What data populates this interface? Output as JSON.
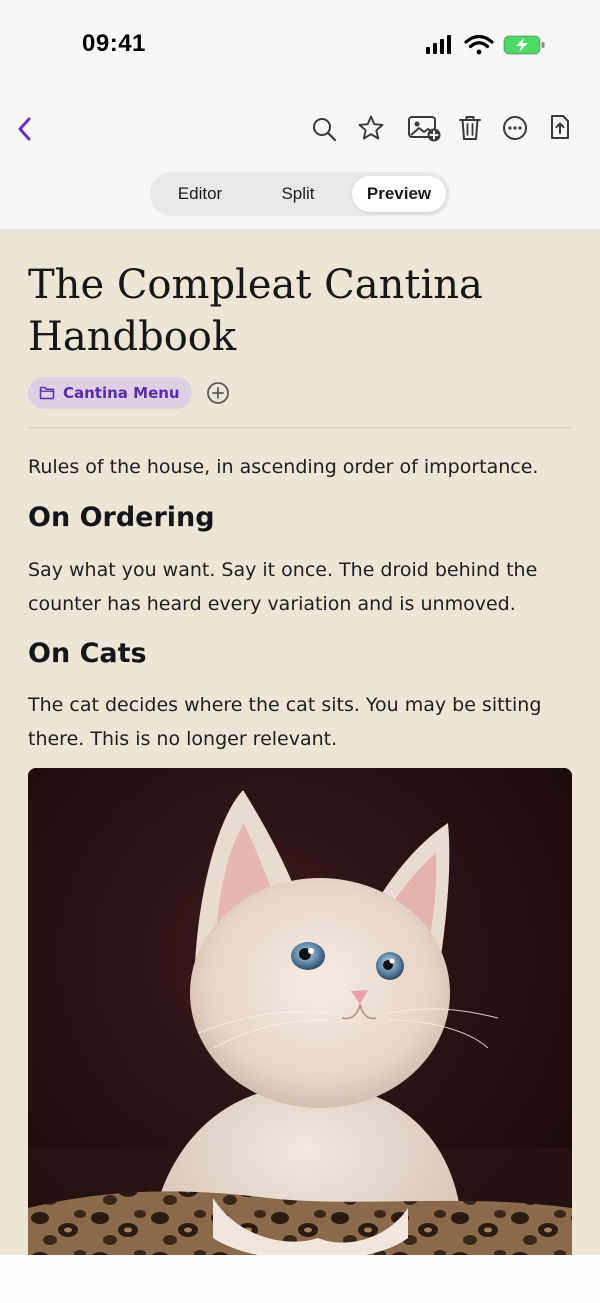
{
  "status": {
    "time": "09:41"
  },
  "toolbar": {
    "back_icon": "chevron-left-icon",
    "icons": [
      "search-icon",
      "star-icon",
      "add-image-icon",
      "trash-icon",
      "more-icon",
      "share-icon"
    ]
  },
  "view_modes": {
    "options": [
      "Editor",
      "Split",
      "Preview"
    ],
    "selected": "Preview"
  },
  "note": {
    "title": "The Compleat Cantina Handbook",
    "tag": "Cantina Menu",
    "intro": "Rules of the house, in ascending order of importance.",
    "sections": [
      {
        "heading": "On Ordering",
        "body": "Say what you want. Say it once. The droid behind the counter has heard every variation and is unmoved."
      },
      {
        "heading": "On Cats",
        "body": "The cat decides where the cat sits. You may be sitting there. This is no longer relevant."
      }
    ],
    "image_subject": "kitten"
  },
  "colors": {
    "accent": "#6a2fc9",
    "page_background": "#ede5d5",
    "tag_background": "#ddd0e4"
  }
}
